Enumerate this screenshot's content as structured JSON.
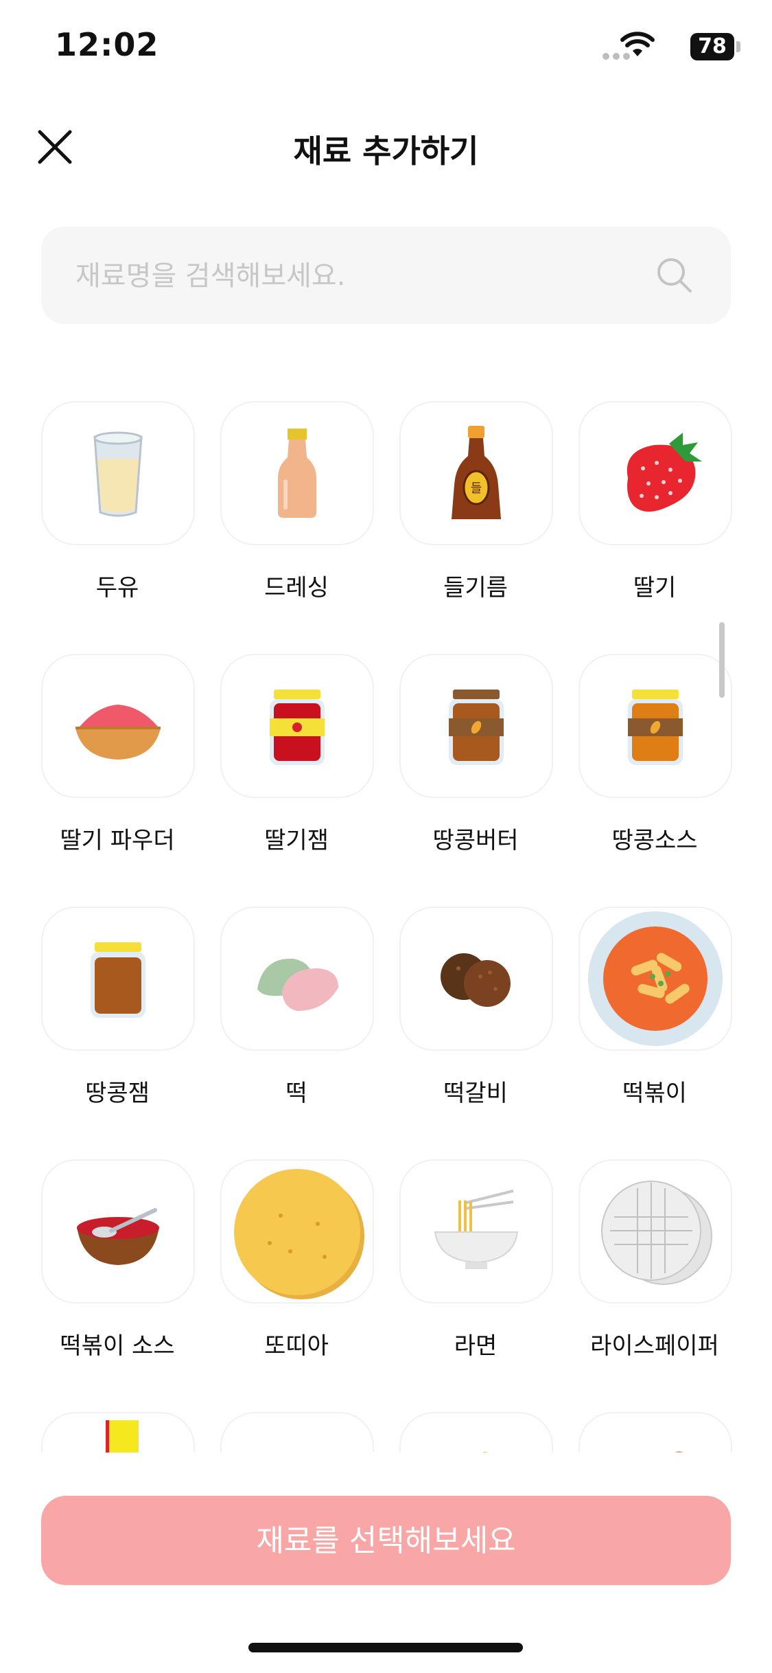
{
  "status_bar": {
    "time": "12:02",
    "battery_percent": "78"
  },
  "header": {
    "title": "재료 추가하기"
  },
  "search": {
    "placeholder": "재료명을 검색해보세요."
  },
  "ingredients": [
    {
      "label": "두유",
      "icon": "soy-milk-glass-icon"
    },
    {
      "label": "드레싱",
      "icon": "dressing-bottle-icon"
    },
    {
      "label": "들기름",
      "icon": "perilla-oil-bottle-icon"
    },
    {
      "label": "딸기",
      "icon": "strawberry-icon"
    },
    {
      "label": "딸기 파우더",
      "icon": "strawberry-powder-bowl-icon"
    },
    {
      "label": "딸기잼",
      "icon": "strawberry-jam-jar-icon"
    },
    {
      "label": "땅콩버터",
      "icon": "peanut-butter-jar-icon"
    },
    {
      "label": "땅콩소스",
      "icon": "peanut-sauce-jar-icon"
    },
    {
      "label": "땅콩잼",
      "icon": "peanut-jam-jar-icon"
    },
    {
      "label": "떡",
      "icon": "rice-cake-icon"
    },
    {
      "label": "떡갈비",
      "icon": "tteokgalbi-patty-icon"
    },
    {
      "label": "떡볶이",
      "icon": "tteokbokki-plate-icon"
    },
    {
      "label": "떡볶이 소스",
      "icon": "tteokbokki-sauce-bowl-icon"
    },
    {
      "label": "또띠아",
      "icon": "tortilla-icon"
    },
    {
      "label": "라면",
      "icon": "ramen-bowl-icon"
    },
    {
      "label": "라이스페이퍼",
      "icon": "rice-paper-icon"
    },
    {
      "label": "",
      "icon": "yellow-package-icon"
    },
    {
      "label": "",
      "icon": "blank-icon"
    },
    {
      "label": "",
      "icon": "small-yellow-item-icon"
    },
    {
      "label": "",
      "icon": "round-brown-item-icon"
    }
  ],
  "bottom_button": {
    "label": "재료를 선택해보세요"
  },
  "colors": {
    "accent_disabled": "#f8a6a6",
    "tile_border": "#f1f1f1",
    "search_bg": "#f6f6f6"
  }
}
